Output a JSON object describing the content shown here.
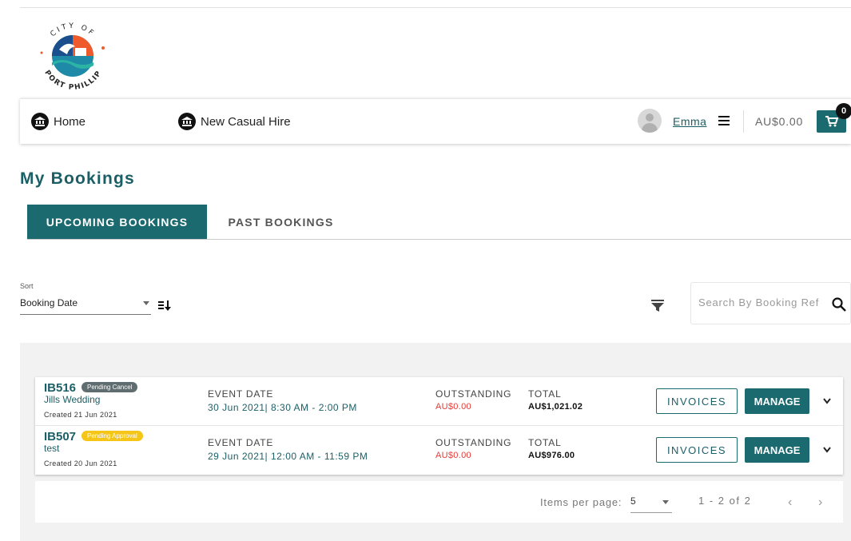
{
  "logo": {
    "top_text": "CITY OF",
    "bottom_text": "PORT PHILLIP"
  },
  "nav": {
    "home_label": "Home",
    "new_hire_label": "New Casual Hire",
    "username": "Emma",
    "cart_amount": "AU$0.00",
    "cart_count": "0"
  },
  "page": {
    "title": "My Bookings"
  },
  "tabs": {
    "upcoming": "UPCOMING BOOKINGS",
    "past": "PAST BOOKINGS"
  },
  "toolbar": {
    "sort_label": "Sort",
    "sort_value": "Booking Date",
    "search_placeholder": "Search By Booking Ref"
  },
  "bookings": [
    {
      "ref": "IB516",
      "status": "Pending Cancel",
      "name": "Jills Wedding",
      "created": "Created 21 Jun 2021",
      "event_label": "EVENT DATE",
      "event_date": "30 Jun 2021| 8:30 AM - 2:00 PM",
      "outstanding_label": "OUTSTANDING",
      "outstanding": "AU$0.00",
      "total_label": "TOTAL",
      "total": "AU$1,021.02",
      "invoices_label": "INVOICES",
      "manage_label": "MANAGE"
    },
    {
      "ref": "IB507",
      "status": "Pending Approval",
      "name": "test",
      "created": "Created 20 Jun 2021",
      "event_label": "EVENT DATE",
      "event_date": "29 Jun 2021| 12:00 AM - 11:59 PM",
      "outstanding_label": "OUTSTANDING",
      "outstanding": "AU$0.00",
      "total_label": "TOTAL",
      "total": "AU$976.00",
      "invoices_label": "INVOICES",
      "manage_label": "MANAGE"
    }
  ],
  "pagination": {
    "items_per_page_label": "Items per page:",
    "items_per_page": "5",
    "range": "1 - 2 of 2",
    "prev": "‹",
    "next": "›"
  },
  "colors": {
    "brand": "#1b6a70",
    "warning": "#f5c518",
    "danger": "#e53935",
    "status_grey": "#5f6d70"
  },
  "icons": [
    "city-logo-icon",
    "bank-icon",
    "avatar-icon",
    "menu-icon",
    "cart-icon",
    "sort-direction-icon",
    "filter-icon",
    "search-icon",
    "chevron-down-icon",
    "chevron-left-icon",
    "chevron-right-icon"
  ]
}
